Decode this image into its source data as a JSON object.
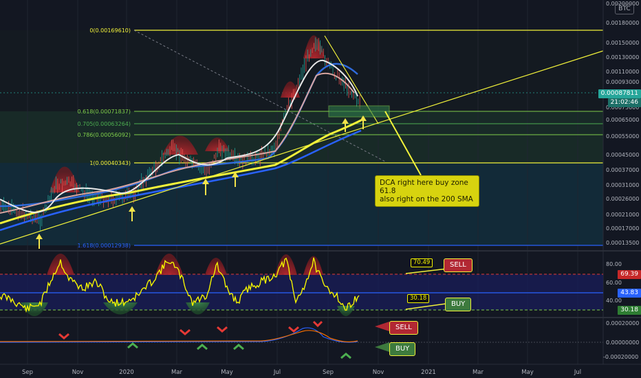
{
  "currency": "BTC",
  "price_axis": {
    "main_ticks": [
      "0.00200000",
      "0.00180000",
      "0.00150000",
      "0.00130000",
      "0.00110000",
      "0.00093000",
      "0.00075000",
      "0.00065000",
      "0.00055000",
      "0.00045000",
      "0.00037000",
      "0.00031000",
      "0.00026000",
      "0.00021000",
      "0.00017000",
      "0.00013500"
    ],
    "current_price": "0.00087811",
    "countdown": "21:02:46",
    "rsi_ticks": [
      "80.00",
      "60.00",
      "40.00"
    ],
    "rsi_overbought": "69.39",
    "rsi_current": "43.83",
    "rsi_low": "30.18",
    "macd_ticks": [
      "0.00020000",
      "0.00000000",
      "-0.00020000"
    ]
  },
  "time_axis": [
    "Sep",
    "Nov",
    "2020",
    "Mar",
    "May",
    "Jul",
    "Sep",
    "Nov",
    "2021",
    "Mar",
    "May",
    "Jul"
  ],
  "fib_levels": [
    {
      "label": "0(0.00169610)"
    },
    {
      "label": "0.618(0.00071837)"
    },
    {
      "label": "0.705(0.00063264)"
    },
    {
      "label": "0.786(0.00056092)"
    },
    {
      "label": "1(0.00040343)"
    },
    {
      "label": "1.618(0.00012938)"
    }
  ],
  "annotations": {
    "dca_note_line1": "DCA right here buy zone 61.8",
    "dca_note_line2": "also right on the 200 SMA",
    "rsi_sell_value": "70.49",
    "rsi_sell_label": "SELL",
    "rsi_buy_value": "30.18",
    "rsi_buy_label": "BUY",
    "macd_sell_label": "SELL",
    "macd_buy_label": "BUY"
  },
  "colors": {
    "background": "#131722",
    "fib_line": "#f2f23a",
    "fib_mid": "#7fcf4a",
    "fib_low": "#2962ff",
    "rsi_line": "#f4f400",
    "sell_red": "#b22833",
    "buy_green": "#3d7a3d",
    "current_price": "#26a69a"
  }
}
